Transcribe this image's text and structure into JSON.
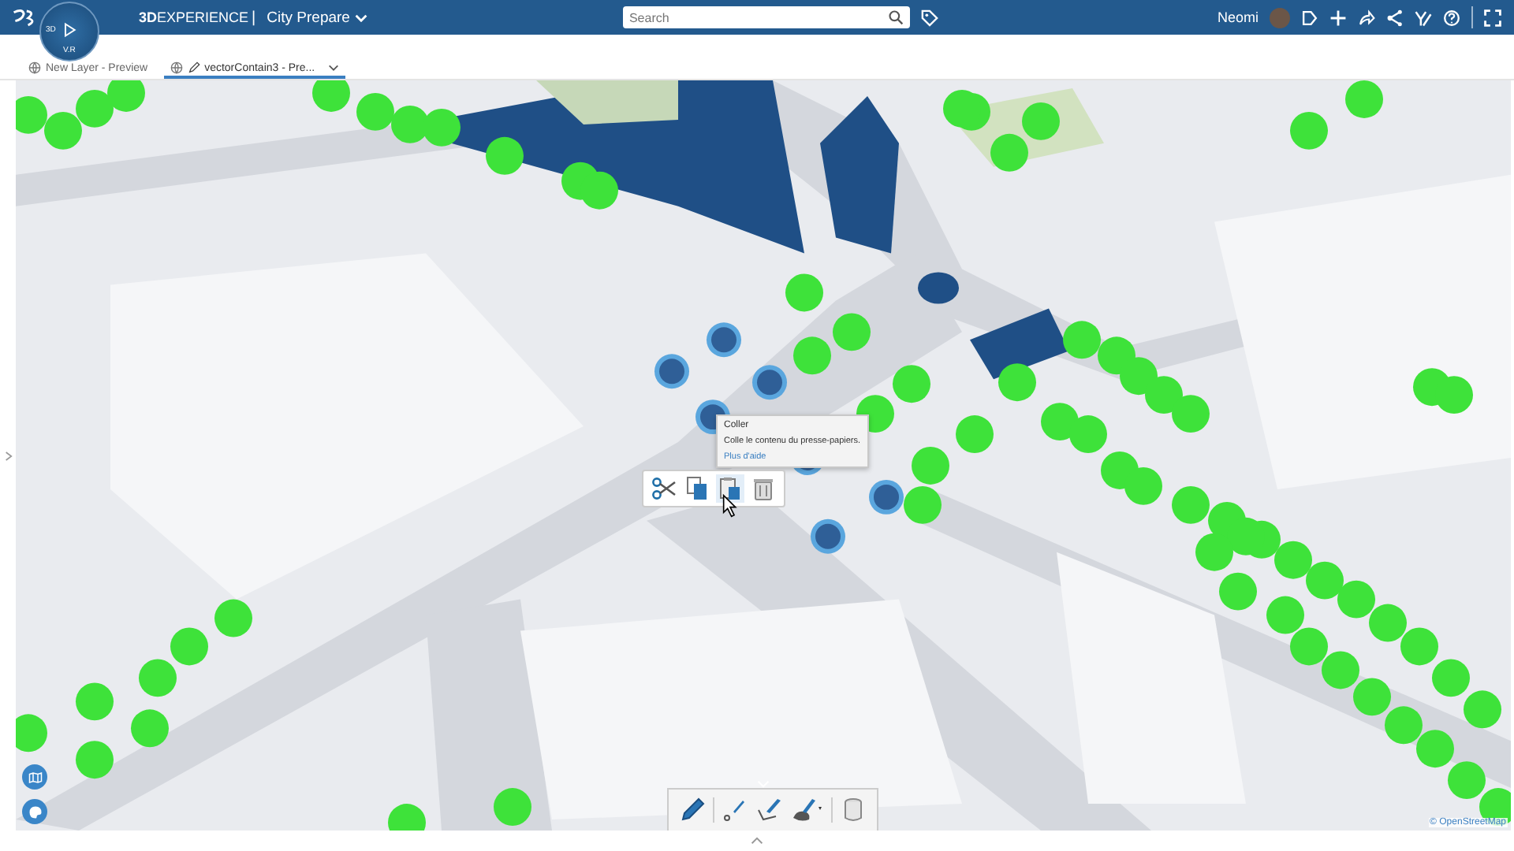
{
  "app_bar": {
    "brand_bold": "3D",
    "brand": "EXPERIENCE",
    "separator": "|",
    "app_name": "City Prepare",
    "search": {
      "placeholder": "Search"
    },
    "user": "Neomi"
  },
  "compass": {
    "left_label": "3D",
    "bottom_label": "V.R"
  },
  "tabs": [
    {
      "label": "New Layer - Preview",
      "selected": false,
      "editable": false
    },
    {
      "label": "vectorContain3 - Pre...",
      "selected": true,
      "editable": true
    }
  ],
  "tooltip": {
    "title": "Coller",
    "description": "Colle le contenu du presse-papiers.",
    "help_link": "Plus d'aide"
  },
  "context_toolbar": [
    {
      "kind": "cut",
      "selected": false
    },
    {
      "kind": "copy",
      "selected": false
    },
    {
      "kind": "paste",
      "selected": true
    },
    {
      "kind": "delete",
      "selected": false
    }
  ],
  "bottom_toolbar": [
    {
      "kind": "pencil"
    },
    {
      "kind": "point"
    },
    {
      "kind": "polyline"
    },
    {
      "kind": "polygon"
    },
    {
      "kind": "database"
    }
  ],
  "attribution": "© OpenStreetMap"
}
